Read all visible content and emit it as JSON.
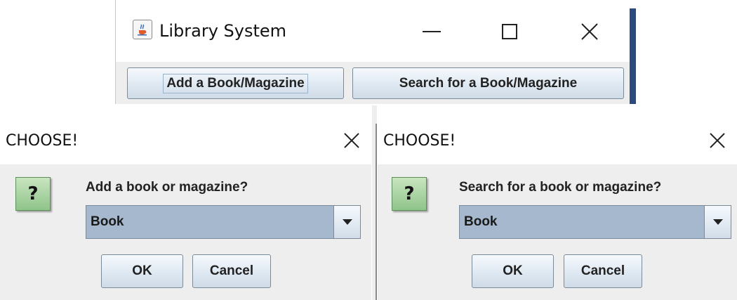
{
  "main_window": {
    "title": "Library System",
    "icon": "java-cup-icon",
    "buttons": {
      "add": "Add a Book/Magazine",
      "search": "Search for a Book/Magazine"
    }
  },
  "dialogs": [
    {
      "title": "CHOOSE!",
      "icon": "question-icon",
      "icon_glyph": "?",
      "message": "Add a book or magazine?",
      "selected": "Book",
      "ok": "OK",
      "cancel": "Cancel"
    },
    {
      "title": "CHOOSE!",
      "icon": "question-icon",
      "icon_glyph": "?",
      "message": "Search for a book or magazine?",
      "selected": "Book",
      "ok": "OK",
      "cancel": "Cancel"
    }
  ],
  "colors": {
    "panel_bg": "#eeeeee",
    "combo_bg": "#a5b8cd",
    "question_green": "#8fc48a",
    "accent_blue": "#2c4a7e"
  }
}
